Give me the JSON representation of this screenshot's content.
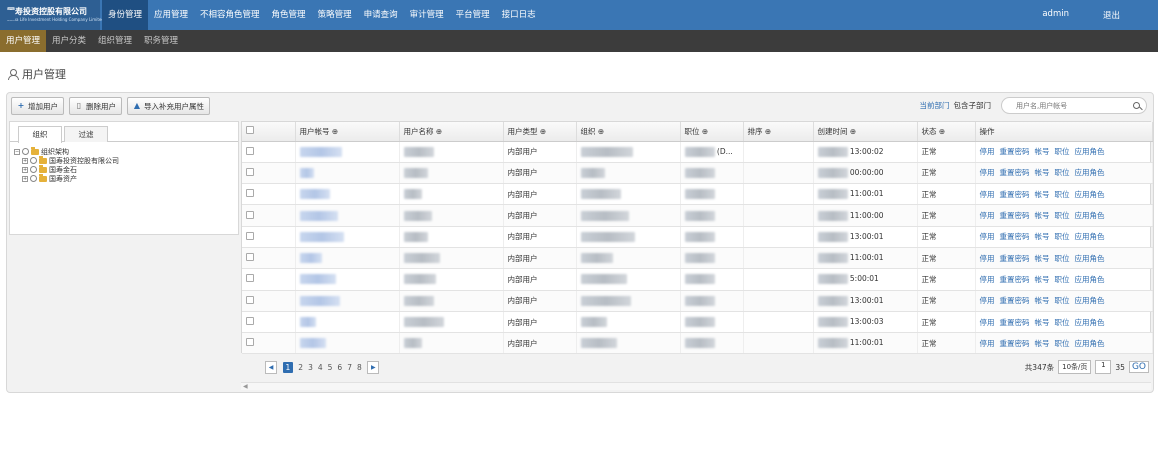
{
  "logo": {
    "name_cn": "国寿投资控股有限公司",
    "name_en": "China Life Investment Holding Company Limited"
  },
  "nav": [
    "身份管理",
    "应用管理",
    "不相容角色管理",
    "角色管理",
    "策略管理",
    "申请查询",
    "审计管理",
    "平台管理",
    "接口日志"
  ],
  "nav_active": 0,
  "user": "admin",
  "logout": "退出",
  "subnav": [
    "用户管理",
    "用户分类",
    "组织管理",
    "职务管理"
  ],
  "subnav_active": 0,
  "page_title": "用户管理",
  "toolbar": {
    "add": "增加用户",
    "delete": "删除用户",
    "import": "导入补充用户属性"
  },
  "right_tools": {
    "current_dept": "当前部门",
    "include_sub": "包含子部门",
    "search_placeholder": "用户名,用户帐号"
  },
  "left_tabs": [
    "组织",
    "过滤"
  ],
  "tree": {
    "root": "组织架构",
    "children": [
      "国寿投资控股有限公司",
      "国寿金石",
      "国寿资产"
    ]
  },
  "columns": [
    "用户帐号 ⊕",
    "用户名称 ⊕",
    "用户类型 ⊕",
    "组织 ⊕",
    "职位 ⊕",
    "排序 ⊕",
    "创建时间 ⊕",
    "状态 ⊕",
    "操作"
  ],
  "rows": [
    {
      "type": "内部用户",
      "pos_suffix": "(D...",
      "time": "13:00:02",
      "status": "正常"
    },
    {
      "type": "内部用户",
      "pos_suffix": "",
      "time": "00:00:00",
      "status": "正常"
    },
    {
      "type": "内部用户",
      "pos_suffix": "",
      "time": "11:00:01",
      "status": "正常"
    },
    {
      "type": "内部用户",
      "pos_suffix": "",
      "time": "11:00:00",
      "status": "正常"
    },
    {
      "type": "内部用户",
      "pos_suffix": "",
      "time": "13:00:01",
      "status": "正常"
    },
    {
      "type": "内部用户",
      "pos_suffix": "",
      "time": "11:00:01",
      "status": "正常"
    },
    {
      "type": "内部用户",
      "pos_suffix": "",
      "time": "5:00:01",
      "status": "正常"
    },
    {
      "type": "内部用户",
      "pos_suffix": "",
      "time": "13:00:01",
      "status": "正常"
    },
    {
      "type": "内部用户",
      "pos_suffix": "",
      "time": "13:00:03",
      "status": "正常"
    },
    {
      "type": "内部用户",
      "pos_suffix": "",
      "time": "11:00:01",
      "status": "正常"
    }
  ],
  "ops": [
    "停用",
    "重置密码",
    "帐号",
    "职位",
    "应用角色"
  ],
  "pager": {
    "pages": [
      "1",
      "2",
      "3",
      "4",
      "5",
      "6",
      "7",
      "8"
    ],
    "current": "1",
    "total_text": "共347条",
    "page_size": "10条/页",
    "page_input": "1",
    "page_count": "35",
    "go": "GO"
  }
}
